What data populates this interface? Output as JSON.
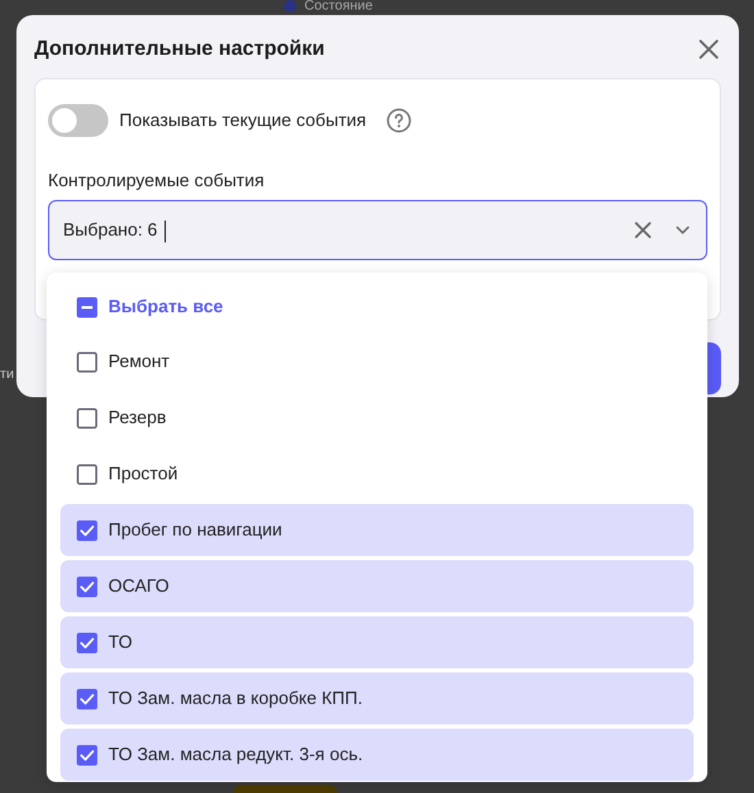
{
  "background": {
    "header_label": "Состояние",
    "side_label": "ти"
  },
  "dialog": {
    "title": "Дополнительные настройки",
    "toggle": {
      "label": "Показывать текущие события",
      "on": false
    },
    "field_label": "Контролируемые события",
    "select": {
      "value": "Выбрано: 6"
    },
    "select_all": {
      "label": "Выбрать все",
      "checked": false,
      "indeterminate": true
    },
    "options": [
      {
        "label": "Ремонт",
        "checked": false
      },
      {
        "label": "Резерв",
        "checked": false
      },
      {
        "label": "Простой",
        "checked": false
      },
      {
        "label": "Пробег по навигации",
        "checked": true
      },
      {
        "label": "ОСАГО",
        "checked": true
      },
      {
        "label": "ТО",
        "checked": true
      },
      {
        "label": "ТО Зам. масла в коробке КПП.",
        "checked": true
      },
      {
        "label": "ТО Зам. масла редукт. 3-я ось.",
        "checked": true
      }
    ]
  }
}
